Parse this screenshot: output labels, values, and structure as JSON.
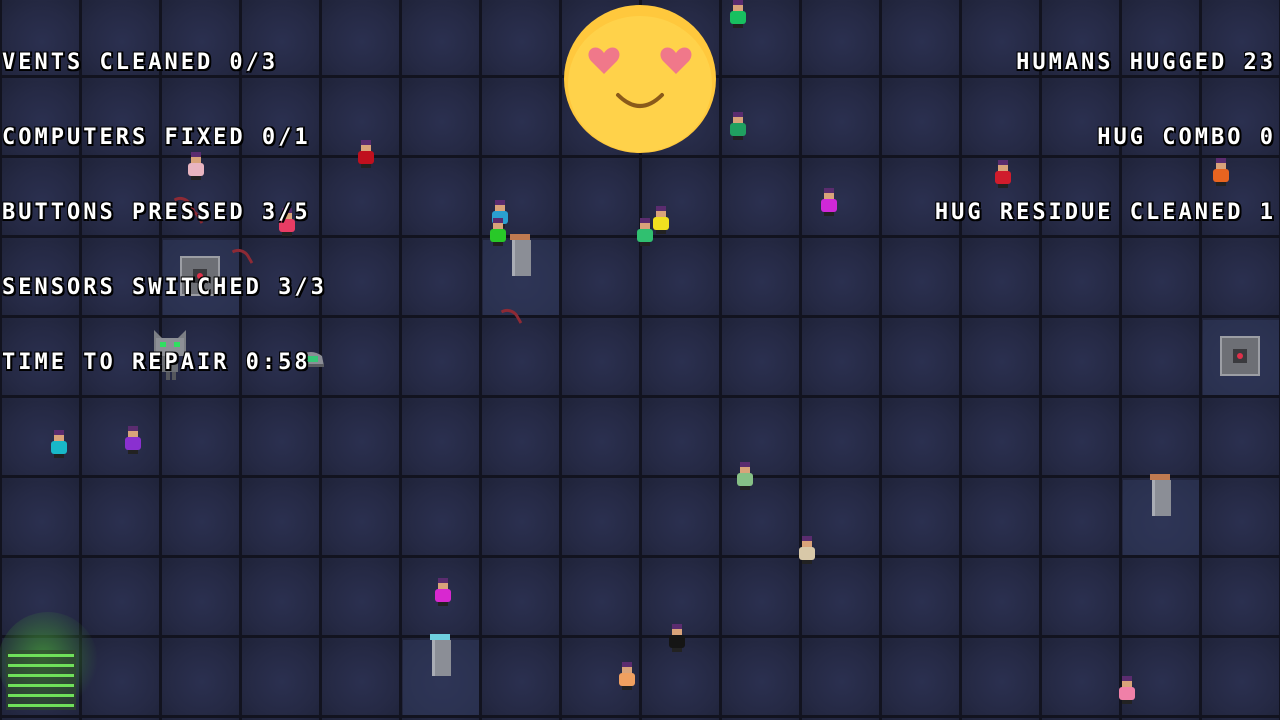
{
  "hud_left": {
    "vents": "VENTS CLEANED 0/3",
    "computers": "COMPUTERS FIXED 0/1",
    "buttons": "BUTTONS PRESSED 3/5",
    "sensors": "SENSORS SWITCHED 3/3",
    "time": "TIME TO REPAIR 0:58"
  },
  "hud_right": {
    "humans": "HUMANS HUGGED 23",
    "combo": "HUG COMBO 0",
    "residue": "HUG RESIDUE CLEANED 1"
  },
  "colors": {
    "text": "#ffffff",
    "floor": "#252944",
    "grid_line": "#12131f",
    "emoji_face": "#ffc83d",
    "emoji_hearts": "#f0788a",
    "vent_light": "#e0304a",
    "residue": "#8e2a35",
    "computer_glow": "#3f8a3a"
  },
  "icons": {
    "mood": "heart-eyes-smiley-icon",
    "player": "robot-cat-icon",
    "vent": "vent-icon",
    "pillar": "button-pillar-icon",
    "sensor": "sensor-icon",
    "computer": "computer-terminal-icon"
  },
  "humans": [
    {
      "color": "#e8b4c0"
    },
    {
      "color": "#c0101e"
    },
    {
      "color": "#e83c64"
    },
    {
      "color": "#2a9fd0"
    },
    {
      "color": "#28c828"
    },
    {
      "color": "#f0e020"
    },
    {
      "color": "#30c070"
    },
    {
      "color": "#20a060"
    },
    {
      "color": "#d028d8"
    },
    {
      "color": "#d01c2c"
    },
    {
      "color": "#e86420"
    },
    {
      "color": "#18b8c8"
    },
    {
      "color": "#8a30d0"
    },
    {
      "color": "#86c086"
    },
    {
      "color": "#d8c8a8"
    },
    {
      "color": "#d828d0"
    },
    {
      "color": "#151515"
    },
    {
      "color": "#f0a060"
    },
    {
      "color": "#f080a8"
    },
    {
      "color": "#18c060"
    }
  ]
}
